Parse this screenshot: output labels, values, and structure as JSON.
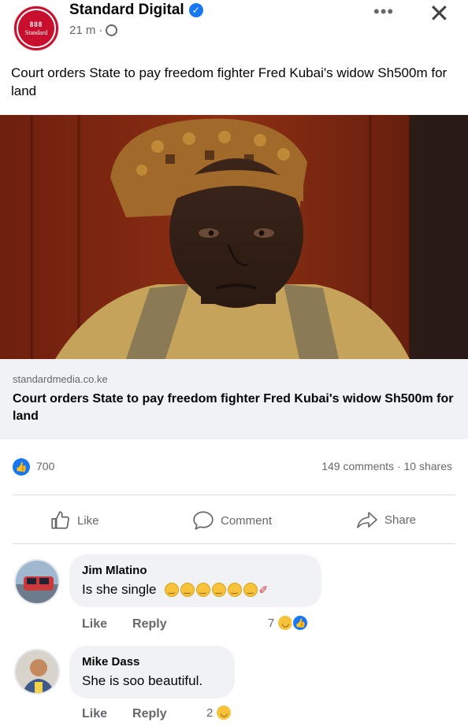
{
  "header": {
    "page_name": "Standard Digital",
    "time": "21 m",
    "separator": "·",
    "more_label": "•••",
    "close_label": "✕",
    "avatar_text": "Standard",
    "avatar_mark": "888"
  },
  "post": {
    "text": "Court orders State to pay freedom fighter Fred Kubai's widow Sh500m for land"
  },
  "link": {
    "domain": "standardmedia.co.ke",
    "title": "Court orders State to pay freedom fighter Fred Kubai's widow Sh500m for land"
  },
  "stats": {
    "likes": "700",
    "comments": "149 comments",
    "dot": "·",
    "shares": "10 shares"
  },
  "actions": {
    "like": "Like",
    "comment": "Comment",
    "share": "Share"
  },
  "comments": [
    {
      "name": "Jim Mlatino",
      "text": "Is she single",
      "like": "Like",
      "reply": "Reply",
      "reaction_count": "7"
    },
    {
      "name": "Mike Dass",
      "text": "She is soo beautiful.",
      "like": "Like",
      "reply": "Reply",
      "reaction_count": "2"
    }
  ],
  "colors": {
    "brand_red": "#c8102e",
    "facebook_blue": "#1877f2",
    "secondary_text": "#65676b",
    "bubble_bg": "#f0f2f5"
  },
  "icons": {
    "verified": "verified-badge-icon",
    "globe": "globe-icon",
    "more": "more-horizontal-icon",
    "close": "close-icon",
    "like": "thumbs-up-icon",
    "comment": "comment-bubble-icon",
    "share": "share-arrow-icon"
  }
}
